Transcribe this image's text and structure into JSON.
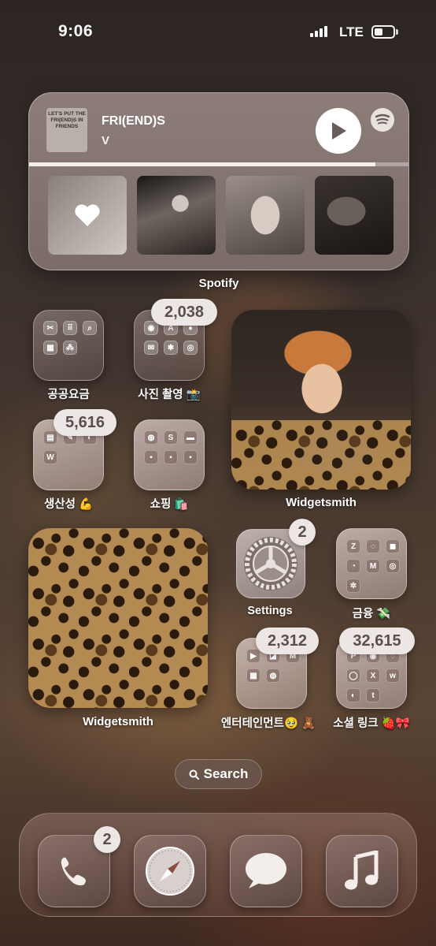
{
  "status_bar": {
    "time": "9:06",
    "network": "LTE",
    "battery_level": 0.45
  },
  "spotify_widget": {
    "album_art_text": "LET'S PUT THE FRI(END)S IN FRIENDS",
    "track_title": "FRI(END)S",
    "artist": "V",
    "progress": 0.91,
    "label": "Spotify",
    "tiles": [
      "heart-icon",
      "photo",
      "photo",
      "photo"
    ]
  },
  "folders": {
    "utilities": {
      "label": "공공요금"
    },
    "camera": {
      "label": "사진 촬영 📸",
      "badge": "2,038"
    },
    "productivity": {
      "label": "생산성 💪",
      "badge": "5,616"
    },
    "shopping": {
      "label": "쇼핑 🛍️"
    },
    "finance": {
      "label": "금융 💸"
    },
    "entertainment": {
      "label": "엔터테인먼트🥹 🧸",
      "badge": "2,312"
    },
    "social": {
      "label": "소셜 링크 🍓🎀",
      "badge": "32,615"
    }
  },
  "widgets": {
    "portrait_label": "Widgetsmith",
    "leopard_label": "Widgetsmith"
  },
  "settings_app": {
    "label": "Settings",
    "badge": "2"
  },
  "search": {
    "label": "Search"
  },
  "dock": {
    "apps": [
      "phone-icon",
      "safari-icon",
      "messages-icon",
      "music-icon"
    ],
    "phone_badge": "2"
  },
  "colors": {
    "widget_bg": "#857571",
    "badge_bg": "#ece7e4",
    "badge_text": "#5a4f4b"
  }
}
